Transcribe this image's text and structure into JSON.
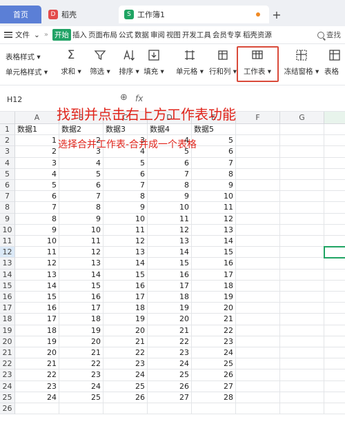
{
  "tabs": {
    "home": "首页",
    "draft": "稻壳",
    "draft_icon": "D",
    "doc": "工作簿1",
    "doc_icon": "S",
    "add": "+"
  },
  "menu": {
    "file": "文件",
    "chevron": "⌄",
    "more": "»",
    "start": "开始",
    "items": [
      "插入",
      "页面布局",
      "公式",
      "数据",
      "审阅",
      "视图",
      "开发工具",
      "会员专享",
      "稻壳资源"
    ],
    "search": "查找"
  },
  "ribbon": {
    "table_style": "表格样式 ▾",
    "cell_style": "单元格样式 ▾",
    "sum": "求和 ▾",
    "filter": "筛选 ▾",
    "sort": "排序 ▾",
    "fill": "填充 ▾",
    "cell": "单元格 ▾",
    "rowcol": "行和列 ▾",
    "worksheet": "工作表 ▾",
    "freeze": "冻结窗格 ▾",
    "table_tools": "表格"
  },
  "formula_bar": {
    "cell_ref": "H12",
    "fx": "fx"
  },
  "columns": [
    "A",
    "B",
    "C",
    "D",
    "E",
    "F",
    "G",
    "H"
  ],
  "header_row": [
    "数据1",
    "数据2",
    "数据3",
    "数据4",
    "数据5"
  ],
  "rows": [
    [
      1,
      2,
      3,
      4,
      5
    ],
    [
      2,
      3,
      4,
      5,
      6
    ],
    [
      3,
      4,
      5,
      6,
      7
    ],
    [
      4,
      5,
      6,
      7,
      8
    ],
    [
      5,
      6,
      7,
      8,
      9
    ],
    [
      6,
      7,
      8,
      9,
      10
    ],
    [
      7,
      8,
      9,
      10,
      11
    ],
    [
      8,
      9,
      10,
      11,
      12
    ],
    [
      9,
      10,
      11,
      12,
      13
    ],
    [
      10,
      11,
      12,
      13,
      14
    ],
    [
      11,
      12,
      13,
      14,
      15
    ],
    [
      12,
      13,
      14,
      15,
      16
    ],
    [
      13,
      14,
      15,
      16,
      17
    ],
    [
      14,
      15,
      16,
      17,
      18
    ],
    [
      15,
      16,
      17,
      18,
      19
    ],
    [
      16,
      17,
      18,
      19,
      20
    ],
    [
      17,
      18,
      19,
      20,
      21
    ],
    [
      18,
      19,
      20,
      21,
      22
    ],
    [
      19,
      20,
      21,
      22,
      23
    ],
    [
      20,
      21,
      22,
      23,
      24
    ],
    [
      21,
      22,
      23,
      24,
      25
    ],
    [
      22,
      23,
      24,
      25,
      26
    ],
    [
      23,
      24,
      25,
      26,
      27
    ],
    [
      24,
      25,
      26,
      27,
      28
    ]
  ],
  "row_numbers": [
    "1",
    "2",
    "3",
    "4",
    "5",
    "6",
    "7",
    "8",
    "9",
    "10",
    "11",
    "12",
    "13",
    "14",
    "15",
    "16",
    "17",
    "18",
    "19",
    "20",
    "21",
    "22",
    "23",
    "24",
    "25",
    "26"
  ],
  "annotation": {
    "main": "找到并点击右上方工作表功能",
    "sub": "选择合并工作表-合并成一个表格"
  },
  "colors": {
    "accent": "#1fa463",
    "highlight": "#d94a3a",
    "annotation": "#e0241b",
    "home_tab": "#5b7fd6"
  }
}
